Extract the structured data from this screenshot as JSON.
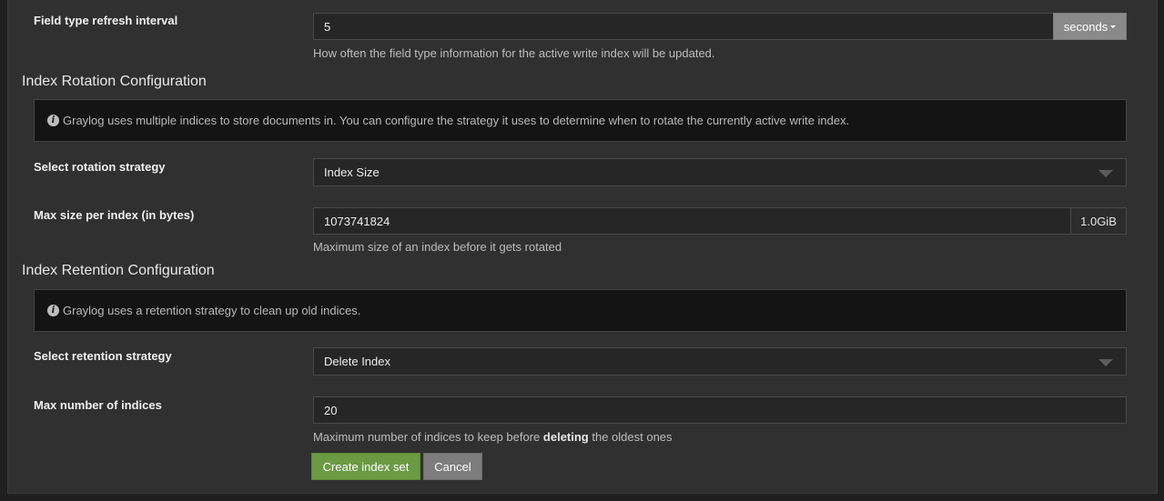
{
  "field_type_refresh": {
    "label": "Field type refresh interval",
    "value": "5",
    "unit_label": "seconds",
    "help": "How often the field type information for the active write index will be updated."
  },
  "rotation": {
    "title": "Index Rotation Configuration",
    "info": "Graylog uses multiple indices to store documents in. You can configure the strategy it uses to determine when to rotate the currently active write index.",
    "strategy_label": "Select rotation strategy",
    "strategy_value": "Index Size",
    "max_size_label": "Max size per index (in bytes)",
    "max_size_value": "1073741824",
    "max_size_addon": "1.0GiB",
    "max_size_help": "Maximum size of an index before it gets rotated"
  },
  "retention": {
    "title": "Index Retention Configuration",
    "info": "Graylog uses a retention strategy to clean up old indices.",
    "strategy_label": "Select retention strategy",
    "strategy_value": "Delete Index",
    "max_indices_label": "Max number of indices",
    "max_indices_value": "20",
    "help_prefix": "Maximum number of indices to keep before ",
    "help_bold": "deleting",
    "help_suffix": " the oldest ones"
  },
  "actions": {
    "create_label": "Create index set",
    "cancel_label": "Cancel"
  },
  "colors": {
    "primary_button": "#6a9a44",
    "cancel_button": "#7d7d7d",
    "panel_bg": "#303030",
    "info_bg": "#141414"
  },
  "icons": {
    "info": "info-circle-icon",
    "dropdown": "caret-down-icon"
  }
}
